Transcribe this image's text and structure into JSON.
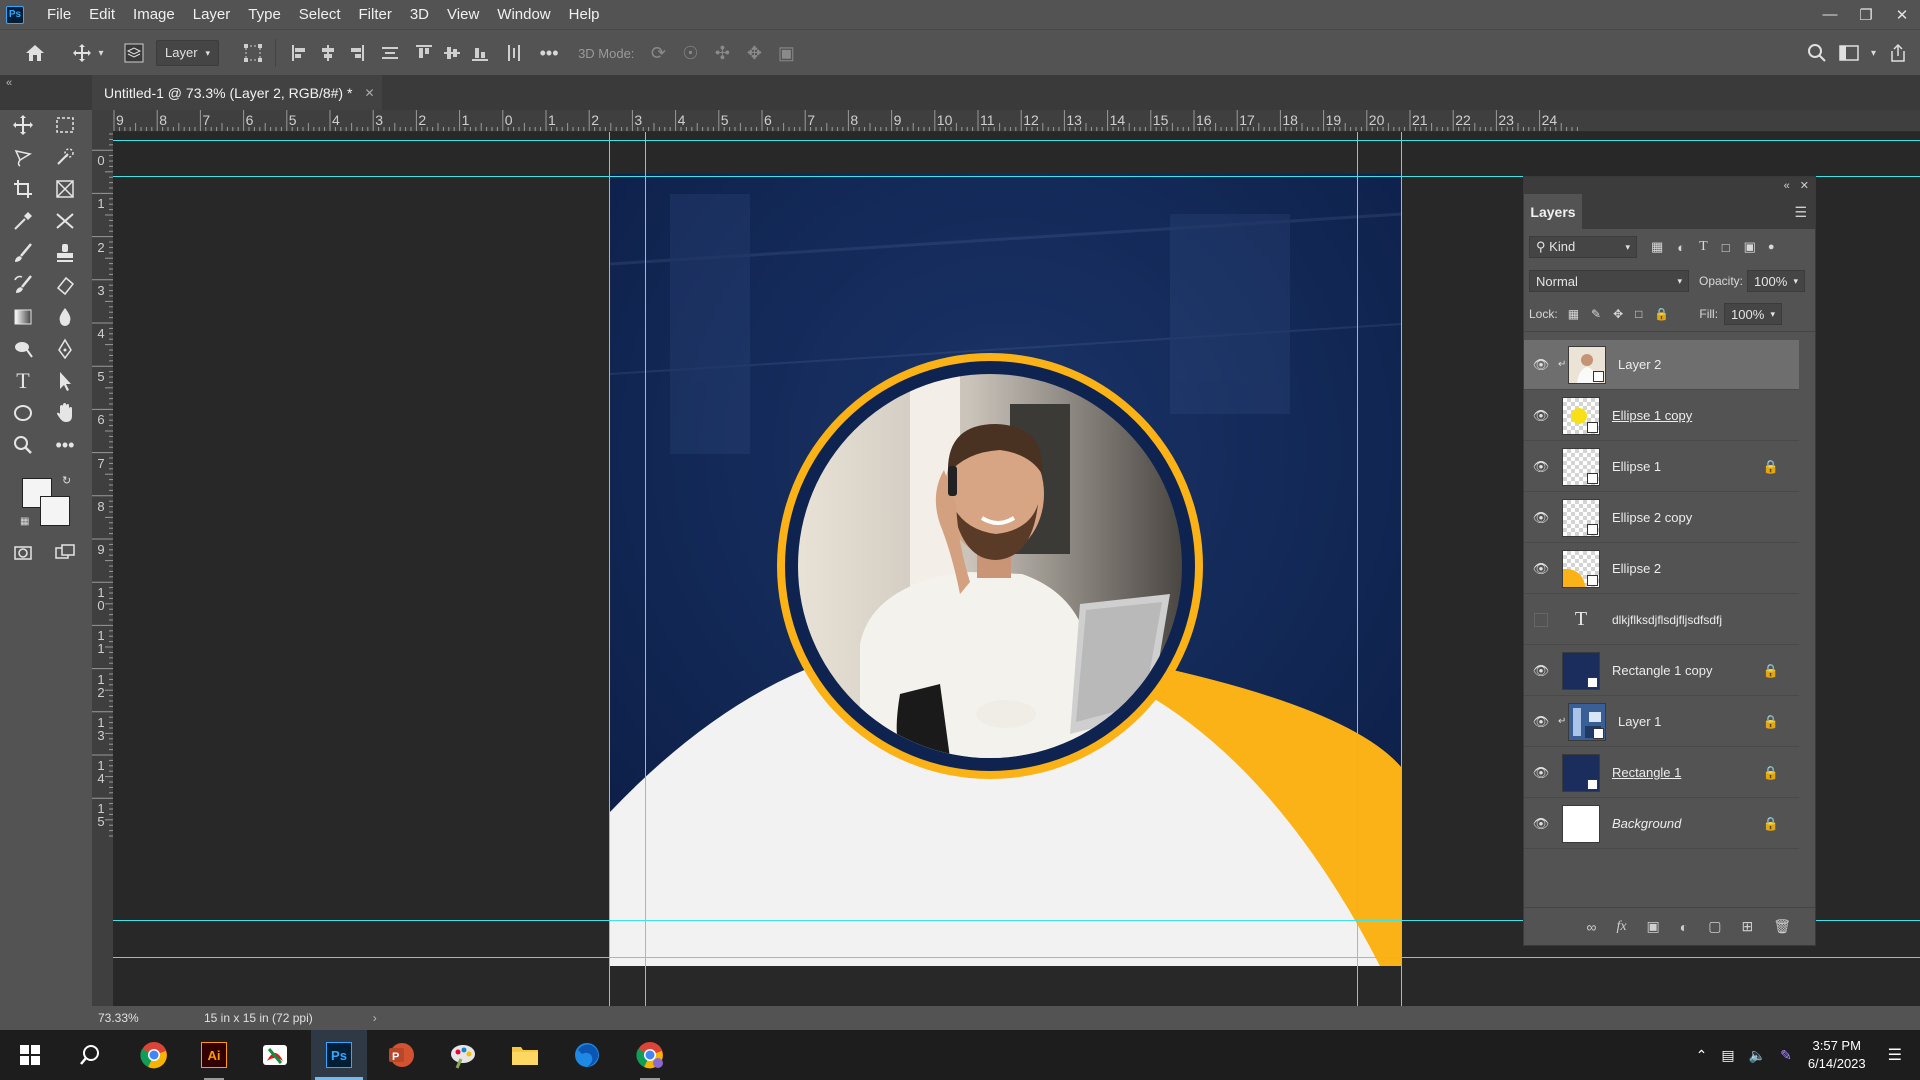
{
  "menubar": {
    "app_logo": "Ps",
    "items": [
      "File",
      "Edit",
      "Image",
      "Layer",
      "Type",
      "Select",
      "Filter",
      "3D",
      "View",
      "Window",
      "Help"
    ]
  },
  "options": {
    "auto_select_target": "Layer",
    "mode_3d_label": "3D Mode:"
  },
  "document": {
    "tab_title": "Untitled-1 @ 73.3% (Layer 2, RGB/8#) *"
  },
  "ruler": {
    "top_labels": [
      "9",
      "8",
      "7",
      "6",
      "5",
      "4",
      "3",
      "2",
      "1",
      "0",
      "1",
      "2",
      "3",
      "4",
      "5",
      "6",
      "7",
      "8",
      "9",
      "10",
      "11",
      "12",
      "13",
      "14",
      "15",
      "16",
      "17",
      "18",
      "19",
      "20",
      "21",
      "22",
      "23",
      "24"
    ],
    "left_labels": [
      "1",
      "0",
      "1",
      "2",
      "3",
      "4",
      "5",
      "6",
      "7",
      "8",
      "9",
      "1 0",
      "1 1",
      "1 2",
      "1 3",
      "1 4",
      "1 5"
    ]
  },
  "layers_panel": {
    "title": "Layers",
    "filter_kind": "Kind",
    "blend_mode": "Normal",
    "opacity_label": "Opacity:",
    "opacity_value": "100%",
    "lock_label": "Lock:",
    "fill_label": "Fill:",
    "fill_value": "100%",
    "layers": [
      {
        "name": "Layer 2",
        "visible": true,
        "locked": false,
        "selected": true
      },
      {
        "name": "Ellipse 1 copy",
        "visible": true,
        "locked": false,
        "selected": false
      },
      {
        "name": "Ellipse 1",
        "visible": true,
        "locked": true,
        "selected": false
      },
      {
        "name": "Ellipse 2 copy",
        "visible": true,
        "locked": false,
        "selected": false
      },
      {
        "name": "Ellipse 2",
        "visible": true,
        "locked": false,
        "selected": false
      },
      {
        "name": "dlkjflksdjflsdjfljsdfsdfj",
        "visible": false,
        "locked": false,
        "selected": false
      },
      {
        "name": "Rectangle 1 copy",
        "visible": true,
        "locked": true,
        "selected": false
      },
      {
        "name": "Layer 1",
        "visible": true,
        "locked": true,
        "selected": false
      },
      {
        "name": "Rectangle 1",
        "visible": true,
        "locked": true,
        "selected": false
      },
      {
        "name": "Background",
        "visible": true,
        "locked": true,
        "selected": false
      }
    ]
  },
  "status": {
    "zoom": "73.33%",
    "doc_info": "15 in x 15 in (72 ppi)"
  },
  "taskbar": {
    "time": "3:57 PM",
    "date": "6/14/2023",
    "apps": [
      "start",
      "search",
      "chrome",
      "illustrator",
      "acrobat",
      "photoshop",
      "powerpoint",
      "paint",
      "file-explorer",
      "firefox",
      "chrome-profile"
    ]
  },
  "colors": {
    "navy": "#0f2350",
    "gold": "#fbb217",
    "light_gray": "#f2f2f2",
    "guide": "#3ee5e8",
    "ps_blue": "#31a8ff"
  }
}
